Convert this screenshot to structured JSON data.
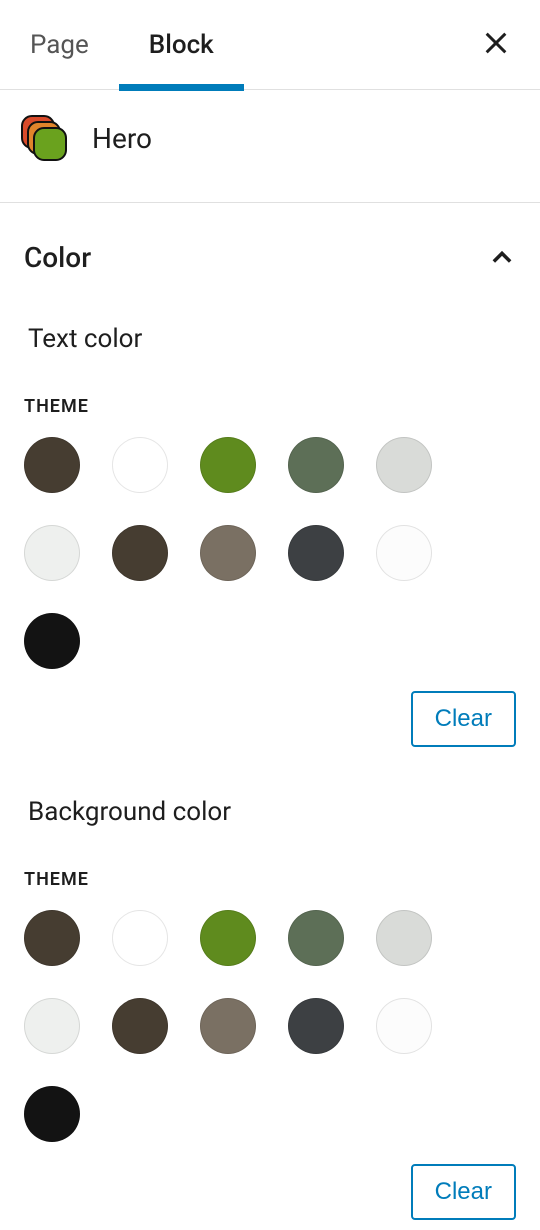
{
  "tabs": {
    "page": "Page",
    "block": "Block"
  },
  "block": {
    "title": "Hero"
  },
  "section": {
    "color_title": "Color"
  },
  "text_color": {
    "label": "Text color",
    "palette_label": "THEME",
    "clear": "Clear"
  },
  "background_color": {
    "label": "Background color",
    "palette_label": "THEME",
    "clear": "Clear"
  },
  "theme_palette": [
    "#463d31",
    "#ffffff",
    "#5f8b1e",
    "#5d6f57",
    "#d9dbd8",
    "#eef0ee",
    "#463d31",
    "#7a7063",
    "#3d4043",
    "#fcfcfc",
    "#131313"
  ]
}
